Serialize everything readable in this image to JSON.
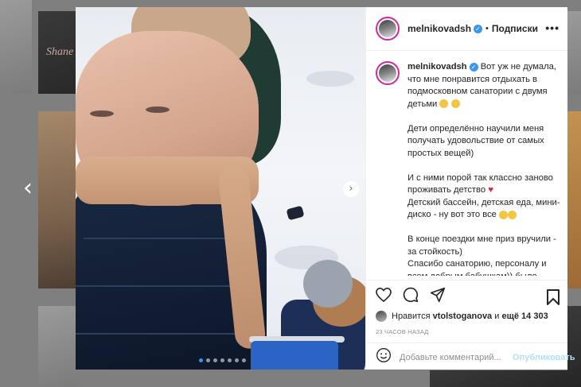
{
  "background": {
    "brand_text": "Shane"
  },
  "navigation": {
    "prev_arrow": "‹",
    "close_symbol": "✕"
  },
  "post": {
    "username": "melnikovadsh",
    "separator": "•",
    "follow_label": "Подписки",
    "more_label": "•••",
    "caption": {
      "author": "melnikovadsh",
      "line1": " Вот уж не думала, что мне понравится отдыхать в подмосковном санатории с двумя детьми",
      "p2": "Дети определённо научили меня получать удовольствие от самых простых вещей)",
      "p3a": "И с ними порой так классно заново проживать детство",
      "p3b": "Детский бассейн, детская еда, мини-диско - ну вот это все",
      "p4": "В конце поездки мне приз вручили - за стойкость)",
      "p5": "Спасибо санаторию, персоналу и всем добрым бабушкам)) было круто)"
    },
    "likes": {
      "prefix": "Нравится",
      "user": "vtolstoganova",
      "middle": "и",
      "count": "ещё 14 303"
    },
    "timestamp": "23 ЧАСОВ НАЗАД",
    "comment_placeholder": "Добавьте комментарий...",
    "publish_label": "Опубликовать"
  },
  "carousel": {
    "next_symbol": "›",
    "dot_count": 7,
    "active_index": 0
  },
  "colors": {
    "accent": "#3897f0",
    "story_ring": "#d6249f",
    "publish_disabled": "#b2dffc"
  },
  "icons": [
    "heart-icon",
    "comment-icon",
    "share-icon",
    "bookmark-icon",
    "emoji-icon",
    "verified-icon",
    "more-icon"
  ]
}
